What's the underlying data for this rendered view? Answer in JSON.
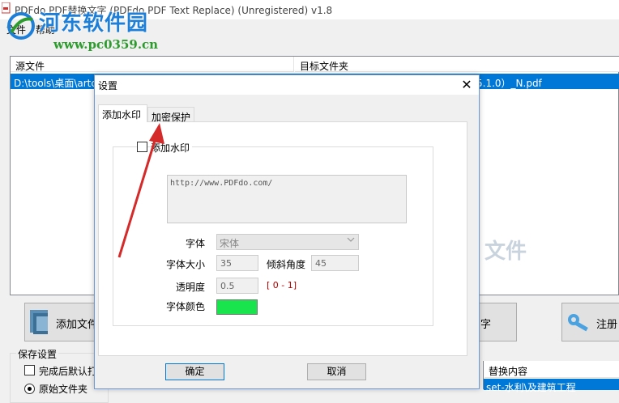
{
  "window": {
    "title": "PDFdo PDF替换文字 (PDFdo PDF Text Replace) (Unregistered) v1.8"
  },
  "menu": [
    "文件",
    "帮助"
  ],
  "watermark_overlay": {
    "site_name": "河东软件园",
    "url": "www.pc0359.cn"
  },
  "file_list": {
    "columns": [
      "源文件",
      "目标文件夹"
    ],
    "rows": [
      {
        "source": "D:\\tools\\桌面\\artcu",
        "target": "5.1.0）_N.pdf"
      }
    ],
    "background_text": "文件"
  },
  "buttons": {
    "add_file": "添加文件",
    "middle": "字",
    "register": "注册"
  },
  "save_settings": {
    "title": "保存设置",
    "checkbox_label": "完成后默认打",
    "radio_label": "原始文件夹"
  },
  "replace_table": {
    "header": "替换内容",
    "row": "set-水利\\及建筑工程"
  },
  "dialog": {
    "title": "设置",
    "close": "✕",
    "tabs": [
      "添加水印",
      "加密保护"
    ],
    "active_tab": 0,
    "add_watermark_label": "添加水印",
    "add_watermark_checked": false,
    "watermark_text": "http://www.PDFdo.com/",
    "fields": {
      "font_label": "字体",
      "font_value": "宋体",
      "font_size_label": "字体大小",
      "font_size_value": "35",
      "tilt_label": "倾斜角度",
      "tilt_value": "45",
      "opacity_label": "透明度",
      "opacity_value": "0.5",
      "opacity_range": "[ 0 - 1]",
      "color_label": "字体颜色",
      "color_value": "#1ae44d"
    },
    "ok": "确定",
    "cancel": "取消"
  },
  "colors": {
    "selection": "#0078d7",
    "annotation_arrow": "#d42a2a",
    "watermark_blue": "#1d7fd8",
    "watermark_green": "#2e9b2e"
  }
}
